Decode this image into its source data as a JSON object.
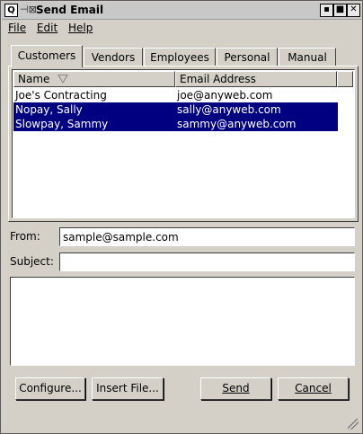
{
  "window": {
    "title": "Send Email",
    "app_icon": "Q",
    "pin_icon": "⊣⊠",
    "minimize_glyph": "▪",
    "maximize_glyph": "■",
    "close_glyph": "✕"
  },
  "menu": [
    {
      "label": "File"
    },
    {
      "label": "Edit"
    },
    {
      "label": "Help"
    }
  ],
  "tabs": [
    {
      "label": "Customers",
      "active": true
    },
    {
      "label": "Vendors"
    },
    {
      "label": "Employees"
    },
    {
      "label": "Personal"
    },
    {
      "label": "Manual"
    }
  ],
  "list": {
    "columns": [
      "Name",
      "Email Address"
    ],
    "rows": [
      {
        "name": "Joe's Contracting",
        "email": "joe@anyweb.com",
        "selected": false
      },
      {
        "name": "Nopay, Sally",
        "email": "sally@anyweb.com",
        "selected": true
      },
      {
        "name": "Slowpay, Sammy",
        "email": "sammy@anyweb.com",
        "selected": true
      }
    ],
    "selection_color": "#000080"
  },
  "form": {
    "from_label": "From:",
    "from_value": "sample@sample.com",
    "subject_label": "Subject:",
    "subject_value": ""
  },
  "buttons": {
    "configure": "Configure...",
    "insert_file": "Insert File...",
    "send": "Send",
    "cancel": "Cancel"
  }
}
